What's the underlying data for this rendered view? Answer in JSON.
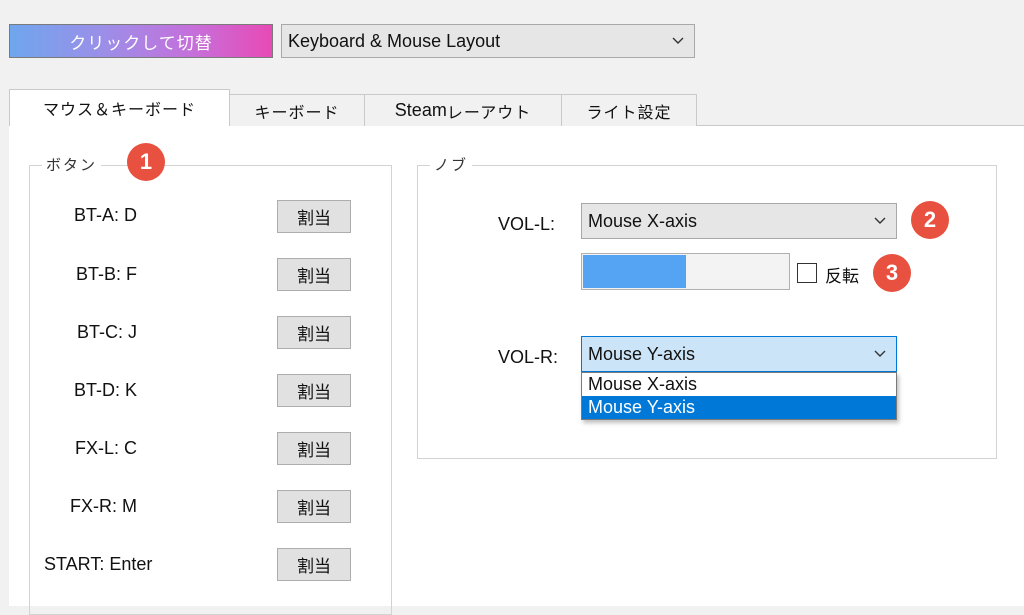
{
  "header": {
    "toggle_label": "クリックして切替",
    "layout_select_value": "Keyboard & Mouse Layout"
  },
  "tabs": [
    {
      "label": "マウス＆キーボード",
      "active": true
    },
    {
      "label": "キーボード",
      "active": false
    },
    {
      "label_latin": "Steam",
      "label": "レーアウト",
      "active": false
    },
    {
      "label": "ライト設定",
      "active": false
    }
  ],
  "buttons_group": {
    "title": "ボタン",
    "assign_label": "割当",
    "rows": [
      {
        "label": "BT-A:",
        "value": "D"
      },
      {
        "label": "BT-B:",
        "value": "F"
      },
      {
        "label": "BT-C:",
        "value": "J"
      },
      {
        "label": "BT-D:",
        "value": "K"
      },
      {
        "label": "FX-L:",
        "value": "C"
      },
      {
        "label": "FX-R:",
        "value": "M"
      },
      {
        "label": "START:",
        "value": "Enter"
      }
    ]
  },
  "knob_group": {
    "title": "ノブ",
    "vol_l": {
      "label": "VOL-L:",
      "value": "Mouse X-axis",
      "level_fraction": 0.5
    },
    "invert_label": "反転",
    "invert_checked": false,
    "vol_r": {
      "label": "VOL-R:",
      "value": "Mouse Y-axis"
    },
    "dropdown_options": [
      "Mouse X-axis",
      "Mouse Y-axis"
    ],
    "dropdown_selected_index": 1
  },
  "badges": [
    "1",
    "2",
    "3"
  ],
  "colors": {
    "badge": "#e8503f",
    "selection": "#0078d7",
    "bar_fill": "#55a4f4"
  }
}
